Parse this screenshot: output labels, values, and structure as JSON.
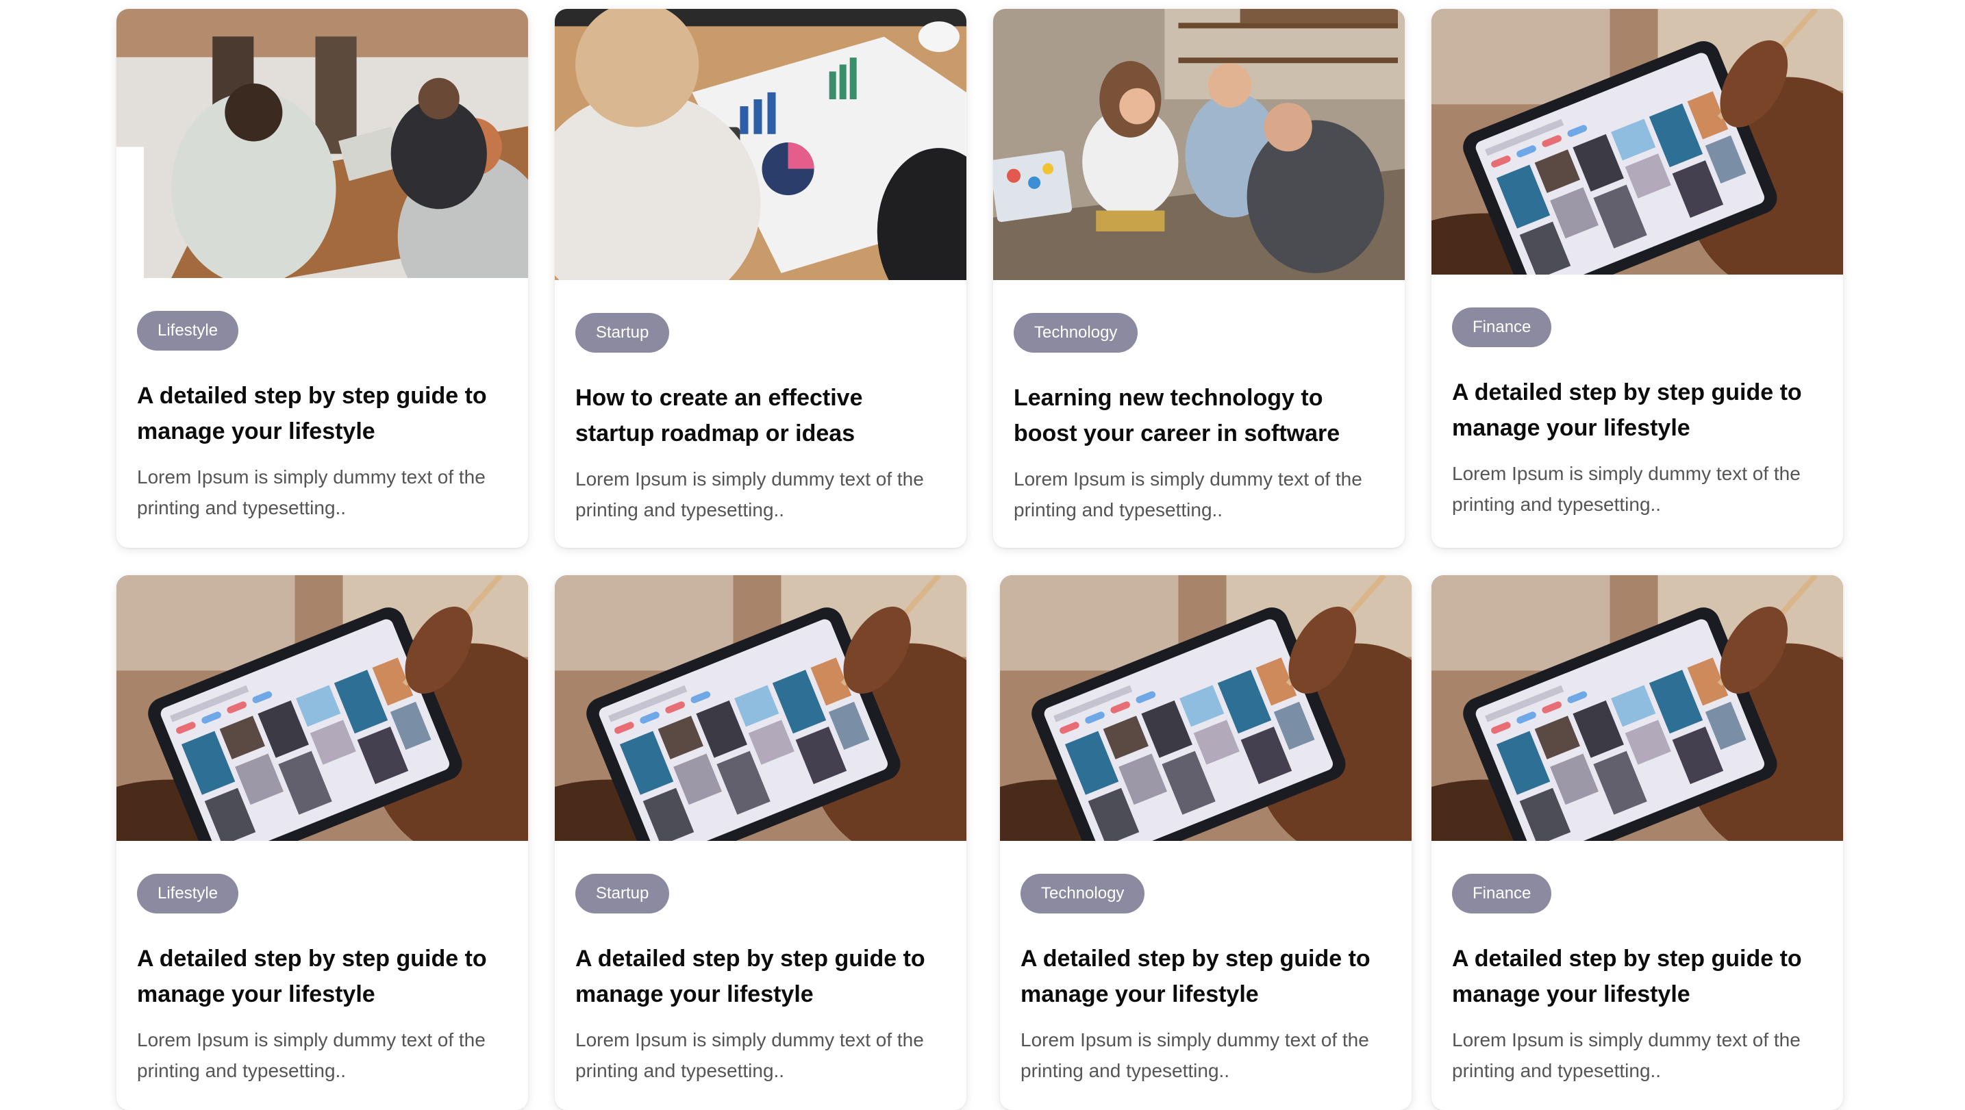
{
  "posts": [
    {
      "category": "Lifestyle",
      "title": "A detailed step by step guide to manage your lifestyle",
      "excerpt": "Lorem Ipsum is simply dummy text of the printing and typesetting..",
      "image": "office-meeting-photo"
    },
    {
      "category": "Startup",
      "title": "How to create an effective startup roadmap or ideas",
      "excerpt": "Lorem Ipsum is simply dummy text of the printing and typesetting..",
      "image": "charts-calculator-photo"
    },
    {
      "category": "Technology",
      "title": "Learning new technology to boost your career in software",
      "excerpt": "Lorem Ipsum is simply dummy text of the printing and typesetting..",
      "image": "students-laptop-photo"
    },
    {
      "category": "Finance",
      "title": "A detailed step by step guide to manage your lifestyle",
      "excerpt": "Lorem Ipsum is simply dummy text of the printing and typesetting..",
      "image": "tablet-gallery-photo"
    },
    {
      "category": "Lifestyle",
      "title": "A detailed step by step guide to manage your lifestyle",
      "excerpt": "Lorem Ipsum is simply dummy text of the printing and typesetting..",
      "image": "tablet-gallery-photo"
    },
    {
      "category": "Startup",
      "title": "A detailed step by step guide to manage your lifestyle",
      "excerpt": "Lorem Ipsum is simply dummy text of the printing and typesetting..",
      "image": "tablet-gallery-photo"
    },
    {
      "category": "Technology",
      "title": "A detailed step by step guide to manage your lifestyle",
      "excerpt": "Lorem Ipsum is simply dummy text of the printing and typesetting..",
      "image": "tablet-gallery-photo"
    },
    {
      "category": "Finance",
      "title": "A detailed step by step guide to manage your lifestyle",
      "excerpt": "Lorem Ipsum is simply dummy text of the printing and typesetting..",
      "image": "tablet-gallery-photo"
    }
  ],
  "colors": {
    "tag_background": "#8c8aa1",
    "tag_text": "#ffffff",
    "title_text": "#0c0c0c",
    "excerpt_text": "#555555"
  }
}
